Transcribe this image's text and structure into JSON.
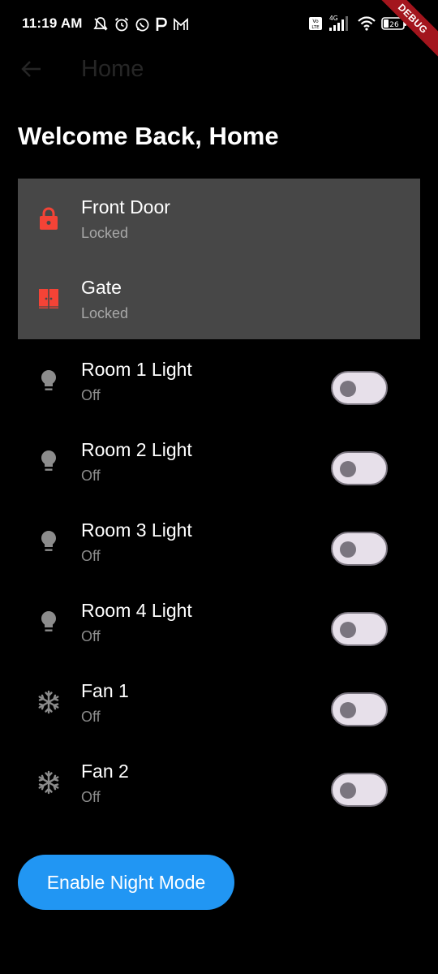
{
  "status_bar": {
    "time": "11:19 AM",
    "battery": "26",
    "network": "4G"
  },
  "debug_banner": "DEBUG",
  "app_bar": {
    "title": "Home"
  },
  "welcome_text": "Welcome Back, Home",
  "locks": [
    {
      "name": "Front Door",
      "status": "Locked",
      "icon": "lock-icon"
    },
    {
      "name": "Gate",
      "status": "Locked",
      "icon": "gate-icon"
    }
  ],
  "devices": [
    {
      "name": "Room 1 Light",
      "status": "Off",
      "icon": "lightbulb-icon",
      "on": false
    },
    {
      "name": "Room 2 Light",
      "status": "Off",
      "icon": "lightbulb-icon",
      "on": false
    },
    {
      "name": "Room 3 Light",
      "status": "Off",
      "icon": "lightbulb-icon",
      "on": false
    },
    {
      "name": "Room 4 Light",
      "status": "Off",
      "icon": "lightbulb-icon",
      "on": false
    },
    {
      "name": "Fan 1",
      "status": "Off",
      "icon": "fan-icon",
      "on": false
    },
    {
      "name": "Fan 2",
      "status": "Off",
      "icon": "fan-icon",
      "on": false
    }
  ],
  "night_mode_button": "Enable Night Mode",
  "colors": {
    "background": "#000000",
    "panel": "#474747",
    "lock_icon": "#f44336",
    "device_icon": "#8c8c8c",
    "toggle_track": "#e7e0ea",
    "toggle_knob": "#7a757f",
    "button": "#2196f3"
  }
}
